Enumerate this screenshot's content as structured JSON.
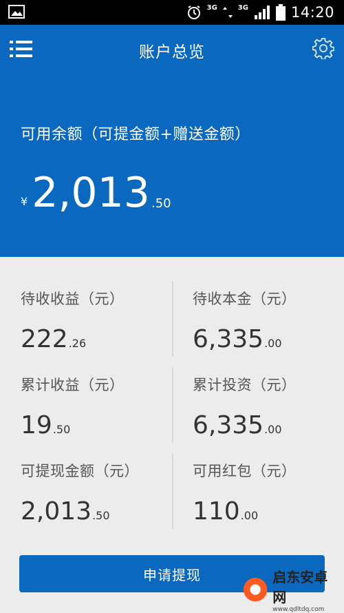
{
  "status_bar": {
    "time": "14:20",
    "network_1": "3G",
    "network_2": "3G"
  },
  "header": {
    "title": "账户总览",
    "menu_icon": "menu-icon",
    "settings_icon": "gear-icon"
  },
  "balance": {
    "label": "可用余额（可提金额+赠送金额）",
    "currency": "¥",
    "integer": "2,013",
    "decimal": ".50"
  },
  "stats": [
    {
      "label": "待收收益（元）",
      "integer": "222",
      "decimal": ".26"
    },
    {
      "label": "待收本金（元）",
      "integer": "6,335",
      "decimal": ".00"
    },
    {
      "label": "累计收益（元）",
      "integer": "19",
      "decimal": ".50"
    },
    {
      "label": "累计投资（元）",
      "integer": "6,335",
      "decimal": ".00"
    },
    {
      "label": "可提现金额（元）",
      "integer": "2,013",
      "decimal": ".50"
    },
    {
      "label": "可用红包（元）",
      "integer": "110",
      "decimal": ".00"
    }
  ],
  "withdraw_button": {
    "label": "申请提现"
  },
  "watermark": {
    "brand": "启东安卓网",
    "url": "www.qdltdq.com"
  },
  "colors": {
    "primary": "#0a68bf",
    "background": "#ececec"
  }
}
